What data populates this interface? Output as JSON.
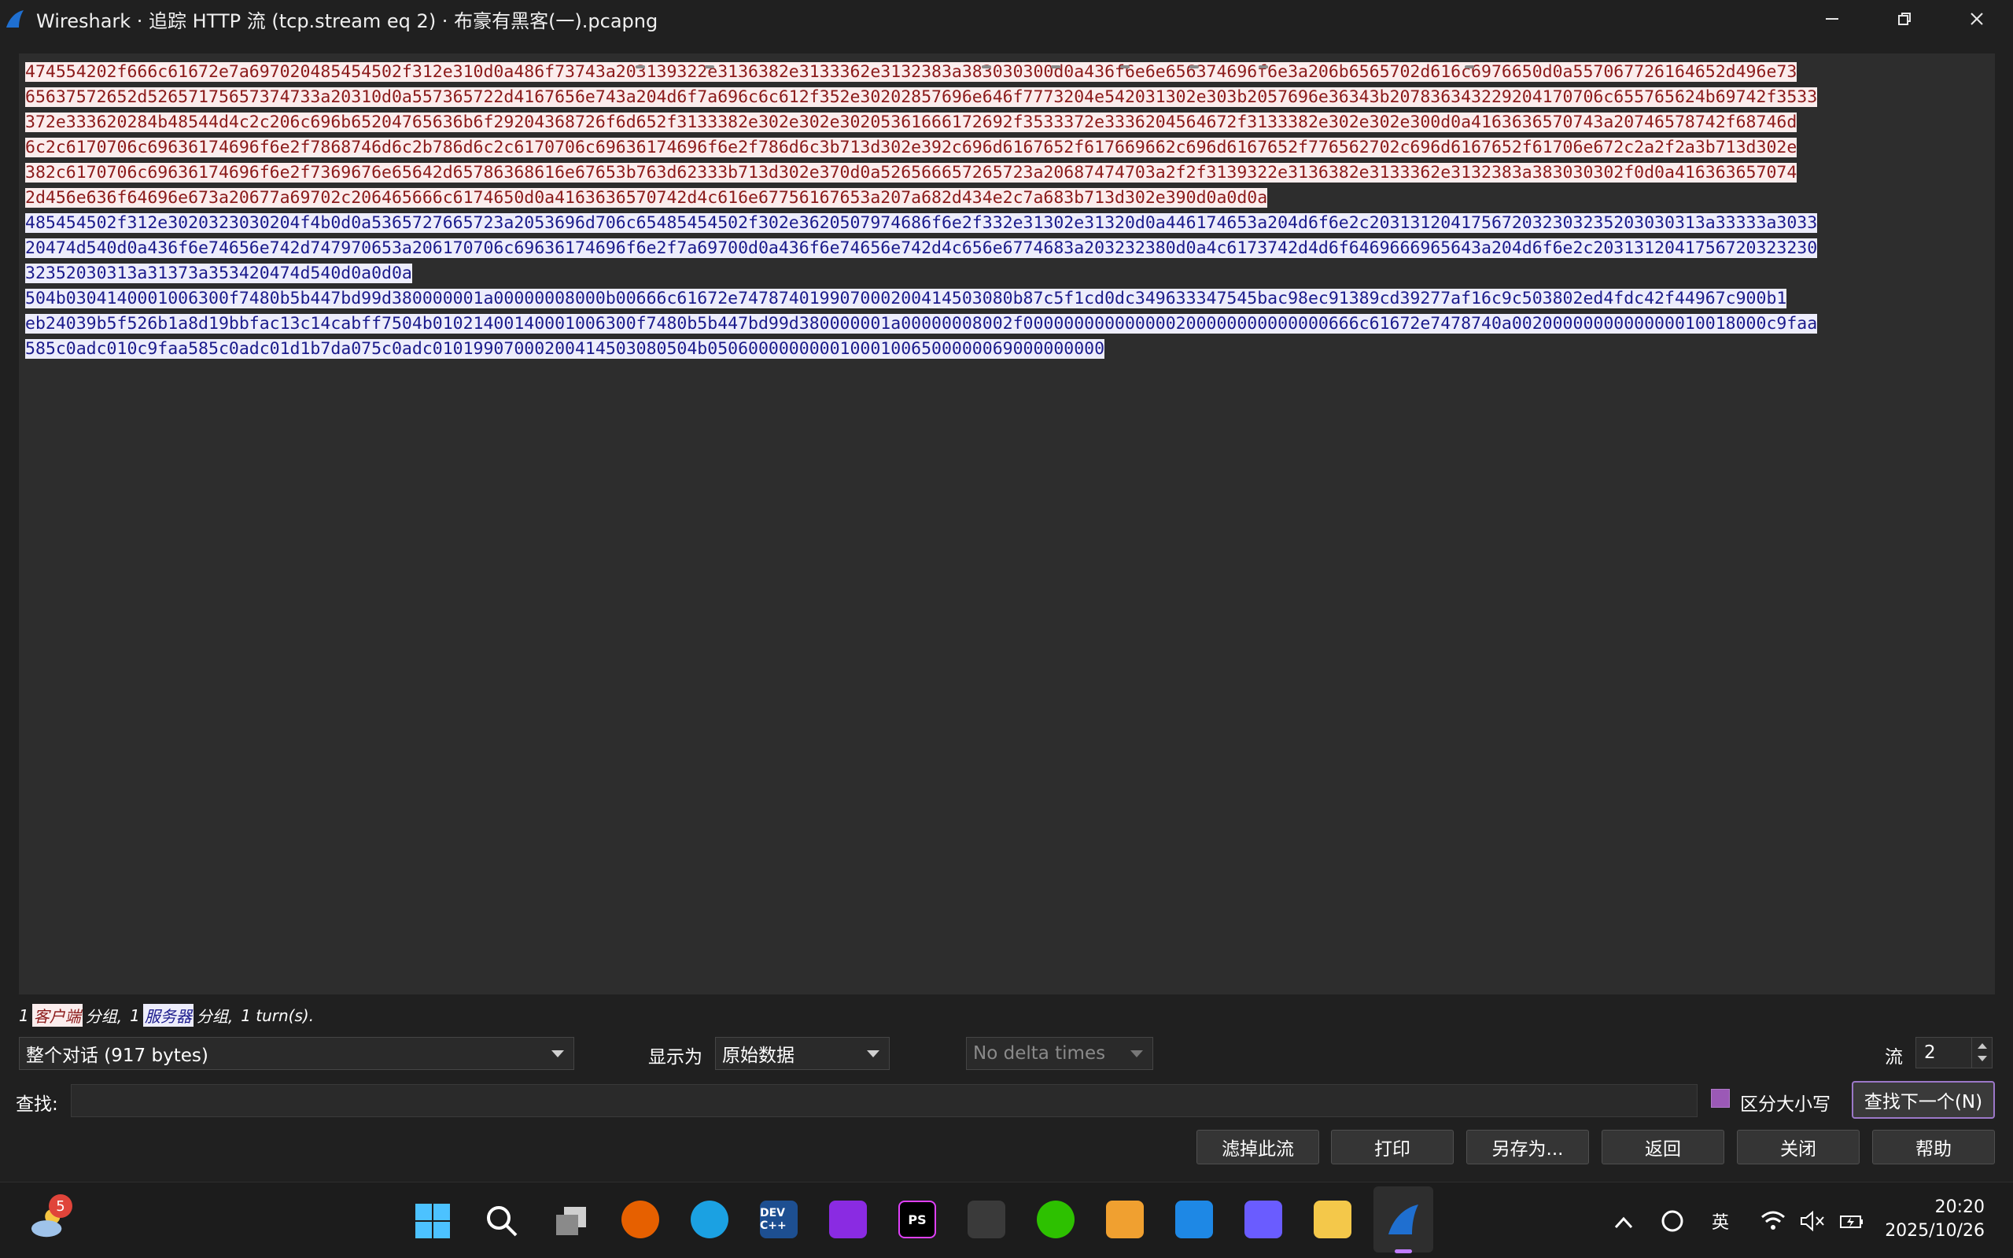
{
  "window": {
    "title": "Wireshark · 追踪 HTTP 流 (tcp.stream eq 2) · 布豪有黑客(一).pcapng"
  },
  "stream": {
    "client_rows_1": [
      "474554202f666c61672e7a697020485454502f312e310d0a486f73743a203139322e3136382e3133362e3132383a383030300d0a436f6e6e656374696f6e3a206b6565702d616c6976650d0a557067726164652d496e73",
      "65637572652d52657175657374733a20310d0a557365722d4167656e743a204d6f7a696c6c612f352e30202857696e646f7773204e542031302e303b2057696e36343b207836343229204170706c655765624b69742f3533",
      "372e333620284b48544d4c2c206c696b65204765636b6f29204368726f6d652f3133382e302e302e30205361666172692f3533372e3336204564672f3133382e302e302e300d0a4163636570743a20746578742f68746d",
      "6c2c6170706c69636174696f6e2f7868746d6c2b786d6c2c6170706c69636174696f6e2f786d6c3b713d302e392c696d6167652f617669662c696d6167652f776562702c696d6167652f61706e672c2a2f2a3b713d302e",
      "382c6170706c69636174696f6e2f7369676e65642d65786368616e67653b763d62333b713d302e370d0a526566657265723a20687474703a2f2f3139322e3136382e3133362e3132383a383030302f0d0a416363657074",
      "2d456e636f64696e673a20677a69702c206465666c6174650d0a4163636570742d4c616e67756167653a207a682d434e2c7a683b713d302e390d0a0d0a"
    ],
    "server_rows_1": [
      "485454502f312e3020323030204f4b0d0a5365727665723a2053696d706c65485454502f302e3620507974686f6e2f332e31302e31320d0a446174653a204d6f6e2c203131204175672032303235203030313a33333a3033",
      "20474d540d0a436f6e74656e742d747970653a206170706c69636174696f6e2f7a69700d0a436f6e74656e742d4c656e6774683a203232380d0a4c6173742d4d6f6469666965643a204d6f6e2c2031312041756720323230",
      "32352030313a31373a353420474d540d0a0d0a"
    ],
    "server_rows_2": [
      "504b0304140001006300f7480b5b447bd99d380000001a00000008000b00666c61672e747874019907000200414503080b87c5f1cd0dc349633347545bac98ec91389cd39277af16c9c503802ed4fdc42f44967c900b1",
      "eb24039b5f526b1a8d19bbfac13c14cabff7504b01021400140001006300f7480b5b447bd99d380000001a00000008002f000000000000000200000000000000666c61672e7478740a0020000000000000010018000c9faa",
      "585c0adc010c9faa585c0adc01d1b7da075c0adc01019907000200414503080504b050600000000010001006500000069000000000"
    ]
  },
  "summary": {
    "count1": "1",
    "client_label": "客户端",
    "pkt_text1": "分组,",
    "count2": "1",
    "server_label": "服务器",
    "pkt_text2": "分组,",
    "turns": "1 turn(s)."
  },
  "controls": {
    "conversation_select": "整个对话 (917 bytes)",
    "show_as_label": "显示为",
    "show_as_select": "原始数据",
    "delta_select": "No delta times",
    "stream_label": "流",
    "stream_value": "2"
  },
  "find": {
    "label": "查找:",
    "value": "",
    "case_label": "区分大小写",
    "find_next": "查找下一个(N)"
  },
  "buttons": {
    "filter_out": "滤掉此流",
    "print": "打印",
    "save_as": "另存为...",
    "back": "返回",
    "close": "关闭",
    "help": "帮助"
  },
  "taskbar": {
    "weather_badge": "5",
    "devcpp_label": "DEV C++",
    "pycharm_label": "PS",
    "tray_lang": "英",
    "time": "20:20",
    "date": "2025/10/26"
  },
  "colors": {
    "client_bg": "#fbeded",
    "client_fg": "#8b1a1a",
    "server_bg": "#ededfb",
    "server_fg": "#1a1a8b",
    "accent": "#9b59b6"
  }
}
